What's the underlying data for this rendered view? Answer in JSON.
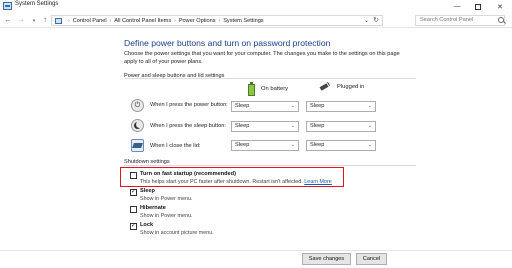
{
  "window": {
    "title": "System Settings",
    "minimize": "—",
    "close": "✕"
  },
  "address": {
    "crumbs": [
      "Control Panel",
      "All Control Panel Items",
      "Power Options",
      "System Settings"
    ],
    "search_placeholder": "Search Control Panel"
  },
  "page": {
    "title": "Define power buttons and turn on password protection",
    "intro": "Choose the power settings that you want for your computer. The changes you make to the settings on this page apply to all of your power plans."
  },
  "power_section": {
    "label": "Power and sleep buttons and lid settings",
    "col_battery": "On battery",
    "col_plugged": "Plugged in",
    "rows": [
      {
        "label": "When I press the power button:",
        "battery": "Sleep",
        "plugged": "Sleep"
      },
      {
        "label": "When I press the sleep button:",
        "battery": "Sleep",
        "plugged": "Sleep"
      },
      {
        "label": "When I close the lid:",
        "battery": "Sleep",
        "plugged": "Sleep"
      }
    ]
  },
  "shutdown_section": {
    "label": "Shutdown settings",
    "items": [
      {
        "label": "Turn on fast startup (recommended)",
        "desc": "This helps start your PC faster after shutdown. Restart isn't affected.",
        "link": "Learn More",
        "checked": false
      },
      {
        "label": "Sleep",
        "desc": "Show in Power menu.",
        "checked": true
      },
      {
        "label": "Hibernate",
        "desc": "Show in Power menu.",
        "checked": false
      },
      {
        "label": "Lock",
        "desc": "Show in account picture menu.",
        "checked": true
      }
    ]
  },
  "buttons": {
    "save": "Save changes",
    "cancel": "Cancel"
  },
  "colors": {
    "title_blue": "#1b3f8f",
    "highlight_red": "#e0141e",
    "link_blue": "#1a5fb4"
  }
}
